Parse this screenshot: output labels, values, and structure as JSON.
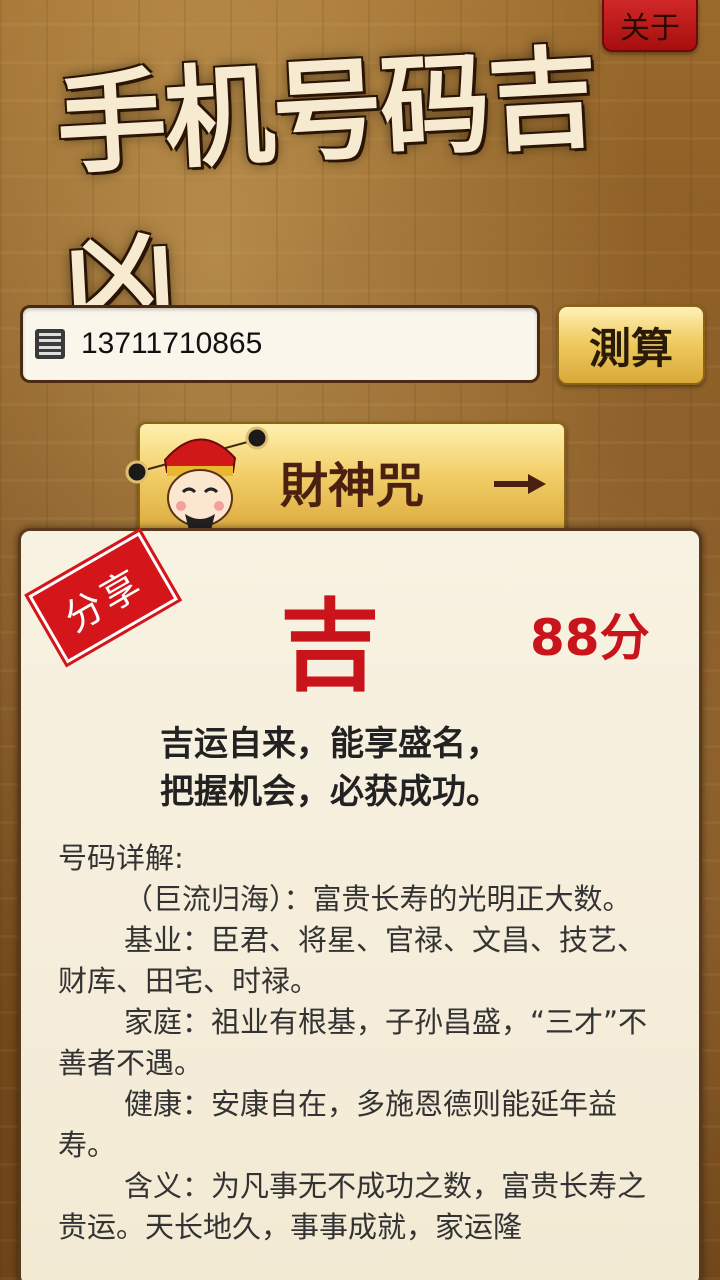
{
  "header": {
    "about_label": "关于",
    "logo_text": "手机号码吉凶"
  },
  "search": {
    "phone_value": "13711710865",
    "calc_label": "測算"
  },
  "banner": {
    "label": "財神咒"
  },
  "result": {
    "share_label": "分享",
    "verdict": "吉",
    "score": "88分",
    "summary_line1": "吉运自来，能享盛名，",
    "summary_line2": "把握机会，必获成功。",
    "detail_title": "号码详解:",
    "detail_paragraphs": [
      "（巨流归海）：富贵长寿的光明正大数。",
      "基业：臣君、将星、官禄、文昌、技艺、财库、田宅、时禄。",
      "家庭：祖业有根基，子孙昌盛，“三才”不善者不遇。",
      "健康：安康自在，多施恩德则能延年益寿。",
      "含义：为凡事无不成功之数，富贵长寿之贵运。天长地久，事事成就，家运隆"
    ]
  },
  "colors": {
    "accent_red": "#c8141a",
    "gold": "#f0cc62",
    "card_bg": "#f8f2e2"
  },
  "icons": [
    "contacts-icon",
    "arrow-right-icon",
    "god-of-wealth-icon"
  ]
}
